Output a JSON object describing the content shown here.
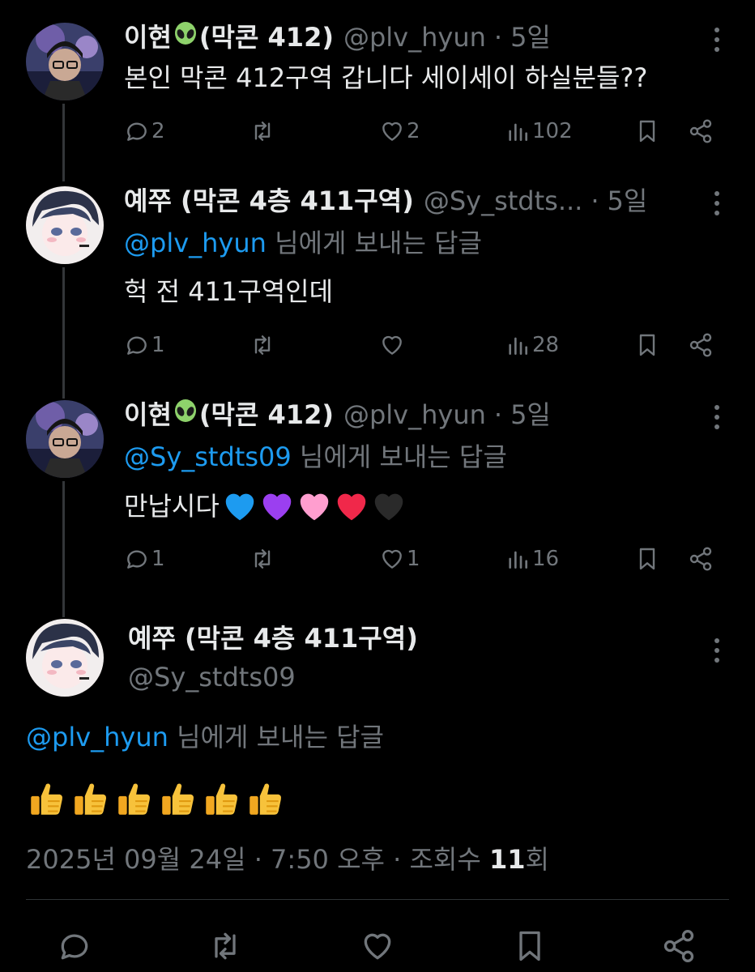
{
  "tweets": [
    {
      "name": "이현",
      "name_suffix": "(막콘 412)",
      "handle": "@plv_hyun",
      "sep": "·",
      "time": "5일",
      "text": "본인 막콘 412구역 갑니다 세이세이 하실분들??",
      "stats": {
        "replies": "2",
        "retweets": "",
        "likes": "2",
        "views": "102"
      }
    },
    {
      "name": "예쭈 (막콘 4층 411구역)",
      "handle": "@Sy_stdts...",
      "sep": "·",
      "time": "5일",
      "reply_mention": "@plv_hyun",
      "reply_suffix": " 님에게 보내는 답글",
      "text": "헉 전 411구역인데",
      "stats": {
        "replies": "1",
        "retweets": "",
        "likes": "",
        "views": "28"
      }
    },
    {
      "name": "이현",
      "name_suffix": "(막콘 412)",
      "handle": "@plv_hyun",
      "sep": "·",
      "time": "5일",
      "reply_mention": "@Sy_stdts09",
      "reply_suffix": " 님에게 보내는 답글",
      "text": "만납시다",
      "hearts": [
        "#1d9bf0",
        "#9b3ff0",
        "#ff9ecf",
        "#f0284a",
        "#2a2a2a"
      ],
      "stats": {
        "replies": "1",
        "retweets": "",
        "likes": "1",
        "views": "16"
      }
    }
  ],
  "main_tweet": {
    "name": "예쭈 (막콘 4층 411구역)",
    "handle": "@Sy_stdts09",
    "reply_mention": "@plv_hyun",
    "reply_suffix": " 님에게 보내는 답글",
    "thumbs_count": 6,
    "date": "2025년 09월 24일 · 7:50 오후 · 조회수 ",
    "views": "11",
    "views_suffix": "회"
  },
  "icons": [
    "reply-icon",
    "retweet-icon",
    "like-icon",
    "views-icon",
    "bookmark-icon",
    "share-icon",
    "more-icon",
    "alien-emoji",
    "thumbs-up-emoji",
    "heart-emoji"
  ],
  "colors": {
    "background": "#000000",
    "text": "#e7e9ea",
    "muted": "#71767b",
    "link": "#1d9bf0",
    "thread_line": "#333639"
  }
}
